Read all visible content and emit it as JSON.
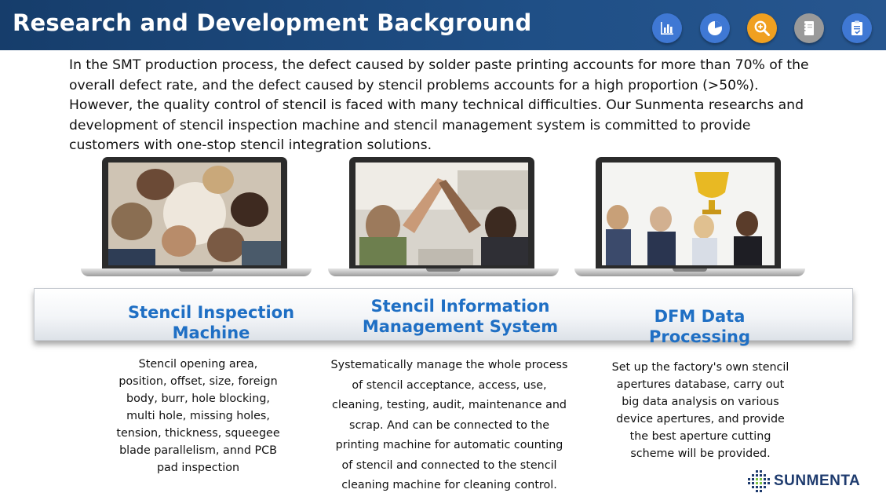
{
  "header": {
    "title": "Research and Development Background",
    "icons": [
      "bar-chart-icon",
      "pie-chart-icon",
      "search-icon",
      "notebook-icon",
      "checklist-icon"
    ]
  },
  "intro": "In the SMT production process, the defect caused by solder paste printing accounts for more than 70% of the overall defect rate, and the defect caused by stencil problems accounts for a high proportion (>50%). However, the quality control of stencil is faced with many technical difficulties. Our Sunmenta researchs and development of stencil inspection machine and stencil management system is committed to provide customers with one-stop stencil integration solutions.",
  "sections": [
    {
      "heading": "Stencil Inspection Machine",
      "description": "Stencil opening area, position, offset, size, foreign body, burr, hole blocking, multi hole, missing holes, tension, thickness, squeegee blade parallelism, annd PCB pad inspection"
    },
    {
      "heading": "Stencil Information Management System",
      "description": "Systematically manage the whole process of stencil acceptance, access, use, cleaning, testing, audit, maintenance and scrap. And can be connected to the printing machine for automatic counting of stencil and connected to the stencil cleaning machine for cleaning control."
    },
    {
      "heading": "DFM Data Processing",
      "description": "Set up the factory's own stencil apertures database, carry out big data analysis on various device apertures, and provide the best aperture cutting scheme will be provided."
    }
  ],
  "logo": {
    "name": "SUNMENTA"
  },
  "colors": {
    "header_bg": "#1f4f86",
    "heading_blue": "#1f6fc4",
    "icon_blue": "#3f78d4",
    "icon_orange": "#f0a020",
    "icon_gray": "#9a9a9a"
  }
}
